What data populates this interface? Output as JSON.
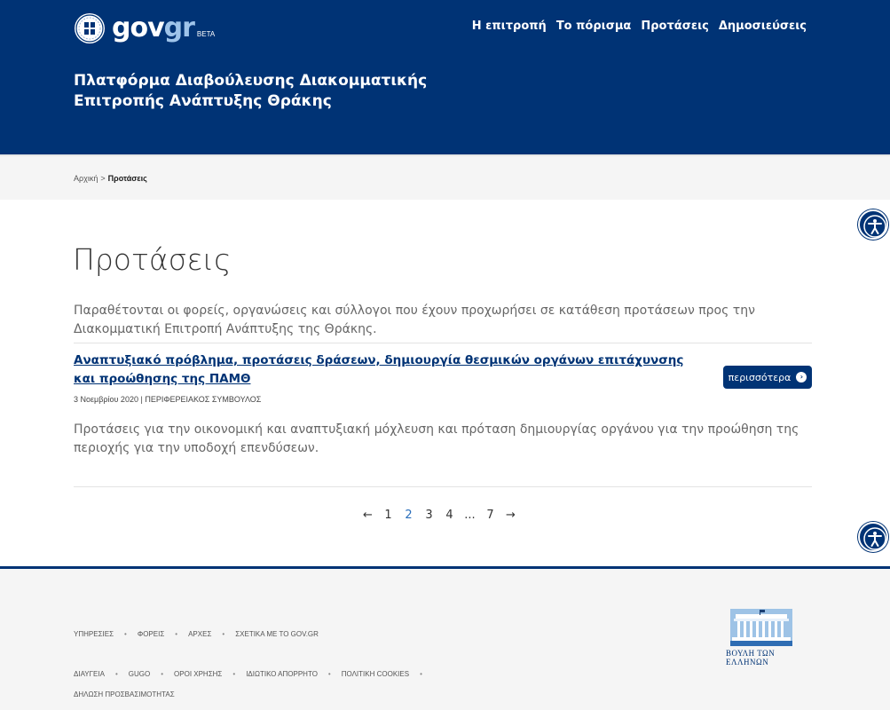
{
  "header": {
    "logo_gov": "gov",
    "logo_gr": "gr",
    "logo_beta": "BETA",
    "nav": [
      "Η επιτροπή",
      "Το πόρισμα",
      "Προτάσεις",
      "Δημοσιεύσεις"
    ],
    "site_title": "Πλατφόρμα Διαβούλευσης Διακομματικής Επιτροπής Ανάπτυξης Θράκης"
  },
  "breadcrumb": {
    "home": "Αρχική",
    "separator": ">",
    "current": "Προτάσεις"
  },
  "main": {
    "title": "Προτάσεις",
    "intro": "Παραθέτονται οι φορείς, οργανώσεις και σύλλογοι που έχουν προχωρήσει σε κατάθεση προτάσεων προς την Διακομματική Επιτροπή Ανάπτυξης της Θράκης.",
    "item": {
      "title": "Αναπτυξιακό πρόβλημα, προτάσεις δράσεων, δημιουργία θεσμικών οργάνων επιτάχυνσης και προώθησης της ΠΑΜΘ",
      "more_label": "περισσότερα",
      "date": "3 Νοεμβρίου 2020",
      "author": "ΠΕΡΙΦΕΡΕΙΑΚΟΣ ΣΥΜΒΟΥΛΟΣ",
      "meta_sep": "|",
      "description": "Προτάσεις για την οικονομική και αναπτυξιακή μόχλευση και πρόταση δημιουργίας οργάνου για την προώθηση της περιοχής για την υποδοχή επενδύσεων."
    },
    "pagination": [
      "←",
      "1",
      "2",
      "3",
      "4",
      "...",
      "7",
      "→"
    ],
    "pagination_active": "2"
  },
  "footer": {
    "links_row1": [
      "ΥΠΗΡΕΣΙΕΣ",
      "ΦΟΡΕΙΣ",
      "ΑΡΧΕΣ",
      "ΣΧΕΤΙΚΑ ΜΕ ΤΟ GOV.GR"
    ],
    "links_row2": [
      "ΔΙΑΥΓΕΙΑ",
      "GUGO",
      "ΟΡΟΙ ΧΡΗΣΗΣ",
      "ΙΔΙΩΤΙΚΟ ΑΠΟΡΡΗΤΟ",
      "ΠΟΛΙΤΙΚΗ COOKIES"
    ],
    "links_row3": [
      "ΔΗΛΩΣΗ ΠΡΟΣΒΑΣΙΜΟΤΗΤΑΣ"
    ],
    "parliament_name": "ΒΟΥΛΗ ΤΩΝ ΕΛΛΗΝΩΝ"
  },
  "colors": {
    "primary": "#003375",
    "link": "#003375",
    "pagination_active": "#2a6ebb"
  },
  "icons": [
    "greek-emblem-icon",
    "accessibility-icon",
    "chevron-right-circle-icon",
    "parliament-building-icon"
  ]
}
